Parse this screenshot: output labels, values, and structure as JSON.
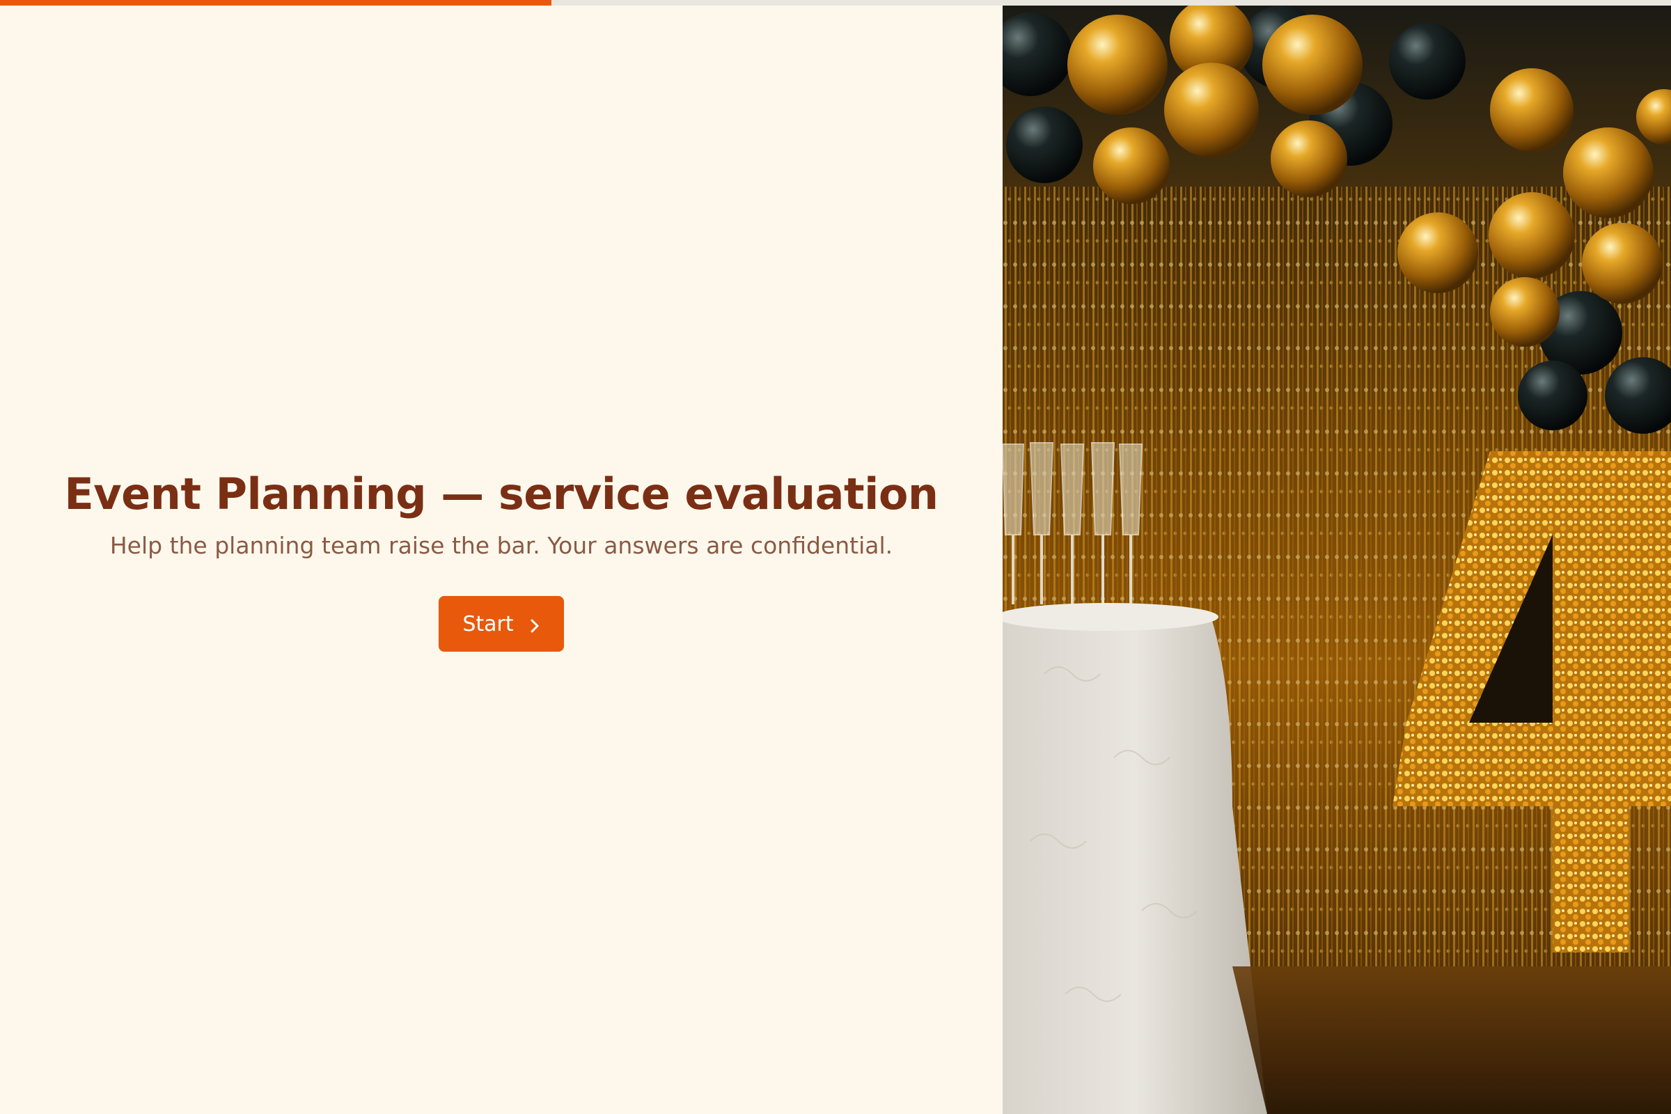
{
  "progress": {
    "percent": 33
  },
  "welcome": {
    "title": "Event Planning — service evaluation",
    "subtitle": "Help the planning team raise the bar. Your answers are confidential.",
    "start_label": "Start"
  },
  "icons": {
    "start_chevron": "chevron-right-icon"
  },
  "hero_image": {
    "description_icon": "party-photo"
  },
  "colors": {
    "accent": "#e8590c",
    "title": "#7a2f14",
    "subtitle": "#8a5a44",
    "background": "#fef8ec"
  }
}
